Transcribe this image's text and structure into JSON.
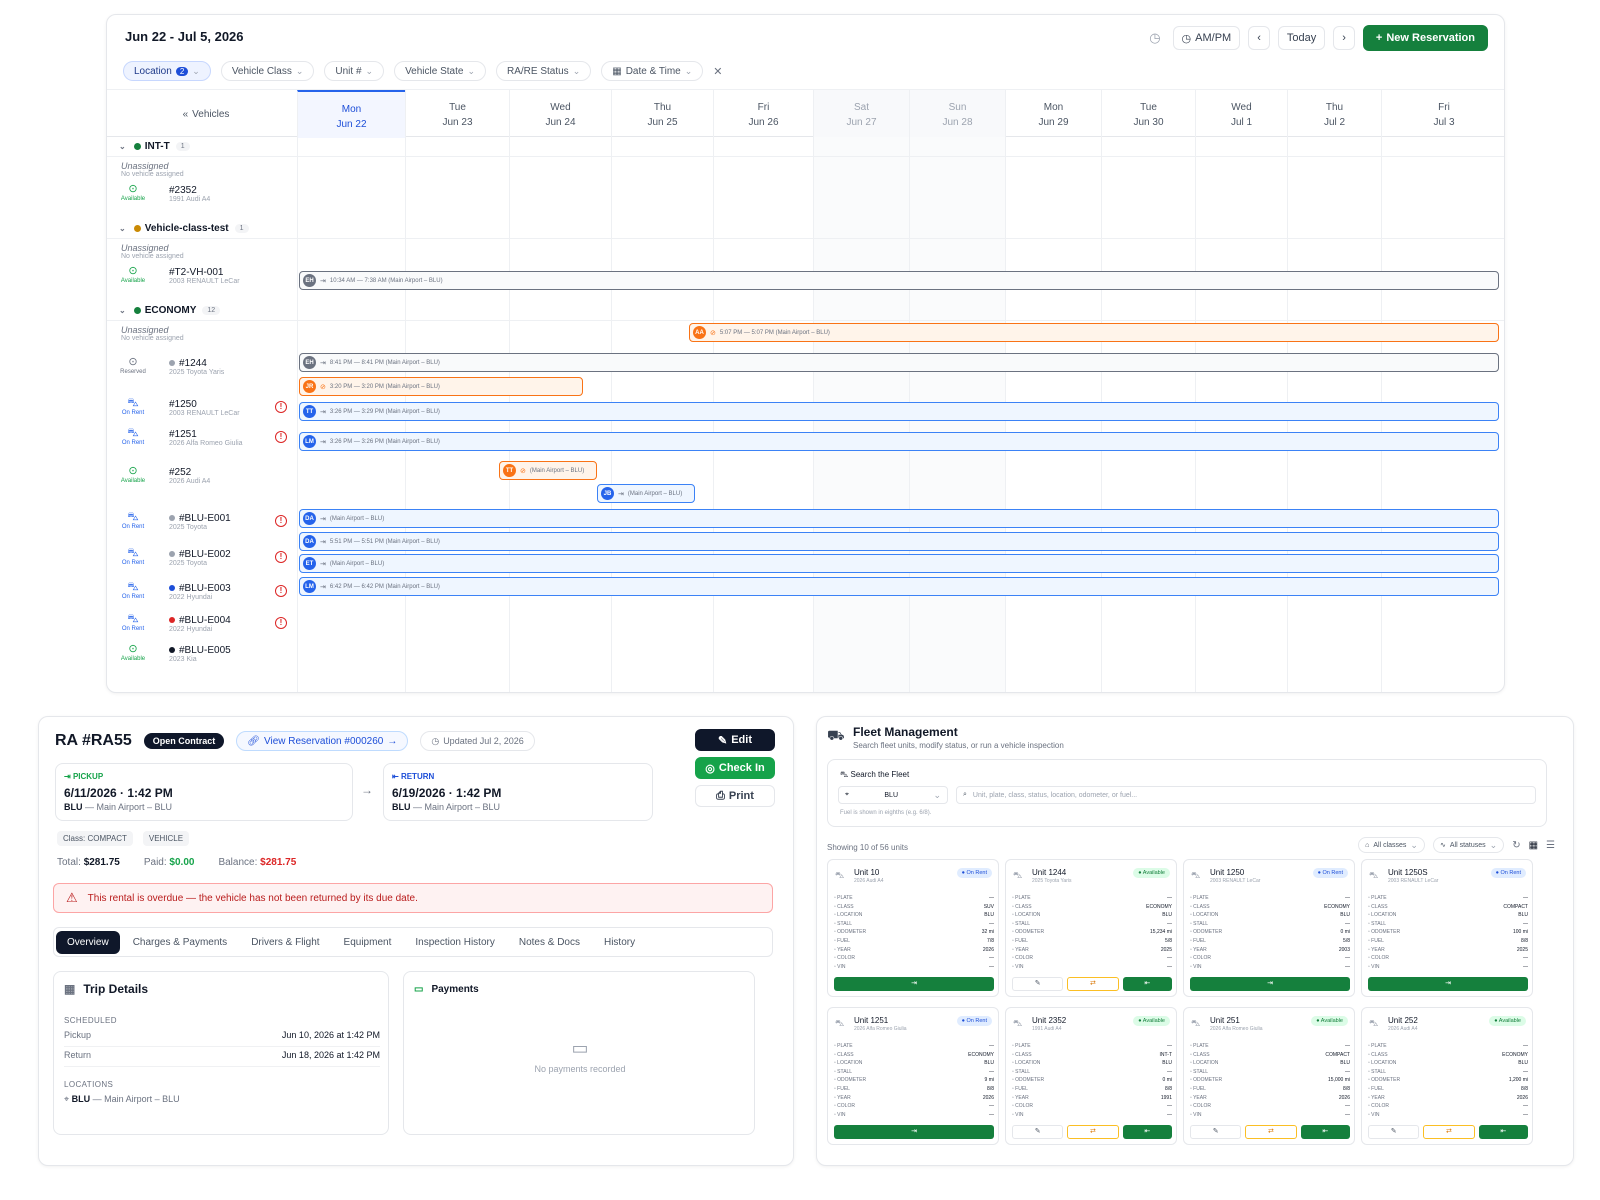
{
  "schedule": {
    "date_range": "Jun 22 - Jul 5, 2026",
    "ampm_label": "AM/PM",
    "today_label": "Today",
    "new_reservation_label": "New Reservation",
    "filters": {
      "location": "Location",
      "location_count": "2",
      "vehicle_class": "Vehicle Class",
      "unit": "Unit #",
      "vehicle_state": "Vehicle State",
      "ra_re_status": "RA/RE Status",
      "date_time": "Date & Time"
    },
    "vehicles_header": "Vehicles",
    "days": [
      {
        "dow": "Mon",
        "date": "Jun 22"
      },
      {
        "dow": "Tue",
        "date": "Jun 23"
      },
      {
        "dow": "Wed",
        "date": "Jun 24"
      },
      {
        "dow": "Thu",
        "date": "Jun 25"
      },
      {
        "dow": "Fri",
        "date": "Jun 26"
      },
      {
        "dow": "Sat",
        "date": "Jun 27"
      },
      {
        "dow": "Sun",
        "date": "Jun 28"
      },
      {
        "dow": "Mon",
        "date": "Jun 29"
      },
      {
        "dow": "Tue",
        "date": "Jun 30"
      },
      {
        "dow": "Wed",
        "date": "Jul 1"
      },
      {
        "dow": "Thu",
        "date": "Jul 2"
      },
      {
        "dow": "Fri",
        "date": "Jul 3"
      }
    ],
    "groups": [
      {
        "name": "INT-T",
        "count": "1",
        "color": "#15803d"
      },
      {
        "name": "Vehicle-class-test",
        "count": "1",
        "color": "#ca8a04"
      },
      {
        "name": "ECONOMY",
        "count": "12",
        "color": "#15803d"
      }
    ],
    "unassigned": "Unassigned",
    "no_vehicle": "No vehicle assigned",
    "vehicles": [
      {
        "unit": "#2352",
        "desc": "1991 Audi A4",
        "status": "Available"
      },
      {
        "unit": "#T2-VH-001",
        "desc": "2003 RENAULT LeCar",
        "status": "Available"
      },
      {
        "unit": "#1244",
        "desc": "2025 Toyota Yaris",
        "status": "Reserved"
      },
      {
        "unit": "#1250",
        "desc": "2003 RENAULT LeCar",
        "status": "On Rent"
      },
      {
        "unit": "#1251",
        "desc": "2026 Alfa Romeo Giulia",
        "status": "On Rent"
      },
      {
        "unit": "#252",
        "desc": "2026 Audi A4",
        "status": "Available"
      },
      {
        "unit": "#BLU-E001",
        "desc": "2025 Toyota",
        "status": "On Rent"
      },
      {
        "unit": "#BLU-E002",
        "desc": "2025 Toyota",
        "status": "On Rent"
      },
      {
        "unit": "#BLU-E003",
        "desc": "2022 Hyundai",
        "status": "On Rent"
      },
      {
        "unit": "#BLU-E004",
        "desc": "2022 Hyundai",
        "status": "On Rent"
      },
      {
        "unit": "#BLU-E005",
        "desc": "2023 Kia",
        "status": "Available"
      }
    ],
    "bookings": [
      {
        "initials": "EH",
        "text": "10:34 AM — 7:38 AM (Main Airport – BLU)"
      },
      {
        "initials": "AA",
        "text": "5:07 PM — 5:07 PM (Main Airport – BLU)"
      },
      {
        "initials": "EH",
        "text": "8:41 PM — 8:41 PM (Main Airport – BLU)"
      },
      {
        "initials": "JR",
        "text": "3:20 PM — 3:20 PM (Main Airport – BLU)"
      },
      {
        "initials": "TT",
        "text": "3:26 PM — 3:29 PM (Main Airport – BLU)"
      },
      {
        "initials": "LM",
        "text": "3:26 PM — 3:26 PM (Main Airport – BLU)"
      },
      {
        "initials": "TT",
        "text": "(Main Airport – BLU)"
      },
      {
        "initials": "JB",
        "text": "(Main Airport – BLU)"
      },
      {
        "initials": "DA",
        "text": "(Main Airport – BLU)"
      },
      {
        "initials": "DA",
        "text": "5:51 PM — 5:51 PM (Main Airport – BLU)"
      },
      {
        "initials": "ET",
        "text": "(Main Airport – BLU)"
      },
      {
        "initials": "LM",
        "text": "6:42 PM — 6:42 PM (Main Airport – BLU)"
      }
    ]
  },
  "ra": {
    "title": "RA #RA55",
    "status_badge": "Open Contract",
    "view_reservation": "View Reservation #000260",
    "updated": "Updated Jul 2, 2026",
    "edit": "Edit",
    "check_in": "Check In",
    "print": "Print",
    "pickup_label": "PICKUP",
    "pickup_dt": "6/11/2026 · 1:42 PM",
    "pickup_loc_code": "BLU",
    "pickup_loc": "— Main Airport – BLU",
    "return_label": "RETURN",
    "return_dt": "6/19/2026 · 1:42 PM",
    "return_loc_code": "BLU",
    "return_loc": "— Main Airport – BLU",
    "class_chip": "Class: COMPACT",
    "vehicle_chip": "VEHICLE",
    "total_label": "Total:",
    "total": "$281.75",
    "paid_label": "Paid:",
    "paid": "$0.00",
    "balance_label": "Balance:",
    "balance": "$281.75",
    "overdue": "This rental is overdue — the vehicle has not been returned by its due date.",
    "tabs": [
      "Overview",
      "Charges & Payments",
      "Drivers & Flight",
      "Equipment",
      "Inspection History",
      "Notes & Docs",
      "History"
    ],
    "trip_title": "Trip Details",
    "scheduled_label": "SCHEDULED",
    "pickup_row_label": "Pickup",
    "pickup_row_value": "Jun 10, 2026 at 1:42 PM",
    "return_row_label": "Return",
    "return_row_value": "Jun 18, 2026 at 1:42 PM",
    "locations_label": "LOCATIONS",
    "location_code": "BLU",
    "location_value": "— Main Airport – BLU",
    "payments_title": "Payments",
    "no_payments": "No payments recorded"
  },
  "fleet": {
    "title": "Fleet Management",
    "subtitle": "Search fleet units, modify status, or run a vehicle inspection",
    "search_title": "Search the Fleet",
    "location_value": "BLU",
    "search_placeholder": "Unit, plate, class, status, location, odometer, or fuel...",
    "hint": "Fuel is shown in eighths (e.g. 6/8).",
    "showing": "Showing 10 of 56 units",
    "all_classes": "All classes",
    "all_statuses": "All statuses",
    "spec_labels": [
      "PLATE",
      "CLASS",
      "LOCATION",
      "STALL",
      "ODOMETER",
      "FUEL",
      "YEAR",
      "COLOR",
      "VIN"
    ],
    "units": [
      {
        "title": "Unit 10",
        "sub": "2026 Audi A4",
        "status": "On Rent",
        "specs": [
          "—",
          "SUV",
          "BLU",
          "—",
          "32 mi",
          "7/8",
          "2026",
          "—",
          "—"
        ]
      },
      {
        "title": "Unit 1244",
        "sub": "2025 Toyota Yaris",
        "status": "Available",
        "specs": [
          "—",
          "ECONOMY",
          "BLU",
          "—",
          "15,234 mi",
          "5/8",
          "2025",
          "—",
          "—"
        ]
      },
      {
        "title": "Unit 1250",
        "sub": "2003 RENAULT LeCar",
        "status": "On Rent",
        "specs": [
          "—",
          "ECONOMY",
          "BLU",
          "—",
          "0 mi",
          "5/8",
          "2003",
          "—",
          "—"
        ]
      },
      {
        "title": "Unit 1250S",
        "sub": "2003 RENAULT LeCar",
        "status": "On Rent",
        "specs": [
          "—",
          "COMPACT",
          "BLU",
          "—",
          "100 mi",
          "8/8",
          "2025",
          "—",
          "—"
        ]
      },
      {
        "title": "Unit 1251",
        "sub": "2026 Alfa Romeo Giulia",
        "status": "On Rent",
        "specs": [
          "—",
          "ECONOMY",
          "BLU",
          "—",
          "9 mi",
          "8/8",
          "2026",
          "—",
          "—"
        ]
      },
      {
        "title": "Unit 2352",
        "sub": "1991 Audi A4",
        "status": "Available",
        "specs": [
          "—",
          "INT-T",
          "BLU",
          "—",
          "0 mi",
          "8/8",
          "1991",
          "—",
          "—"
        ]
      },
      {
        "title": "Unit 251",
        "sub": "2026 Alfa Romeo Giulia",
        "status": "Available",
        "specs": [
          "—",
          "COMPACT",
          "BLU",
          "—",
          "15,000 mi",
          "8/8",
          "2026",
          "—",
          "—"
        ]
      },
      {
        "title": "Unit 252",
        "sub": "2026 Audi A4",
        "status": "Available",
        "specs": [
          "—",
          "ECONOMY",
          "BLU",
          "—",
          "1,200 mi",
          "8/8",
          "2026",
          "—",
          "—"
        ]
      }
    ]
  },
  "colors": {
    "accent": "#15803d",
    "blue": "#2563eb",
    "orange": "#f97316",
    "danger": "#dc2626",
    "dark": "#0f172a"
  }
}
